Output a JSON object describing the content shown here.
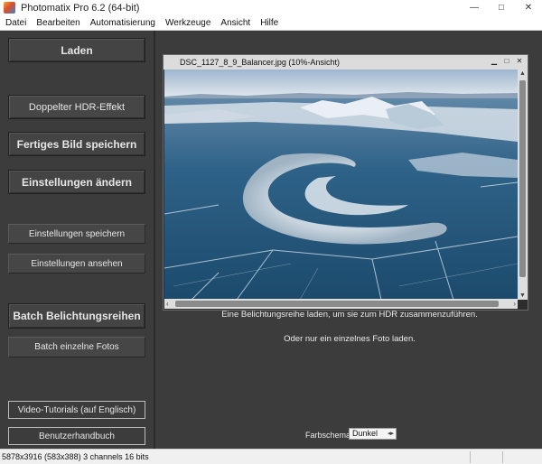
{
  "window": {
    "title": "Photomatix Pro 6.2 (64-bit)",
    "controls": [
      "—",
      "□",
      "✕"
    ]
  },
  "menu": [
    "Datei",
    "Bearbeiten",
    "Automatisierung",
    "Werkzeuge",
    "Ansicht",
    "Hilfe"
  ],
  "sidebar": {
    "load": "Laden",
    "double_hdr": "Doppelter HDR-Effekt",
    "save_final": "Fertiges Bild speichern",
    "change_settings": "Einstellungen ändern",
    "save_settings": "Einstellungen speichern",
    "view_settings": "Einstellungen ansehen",
    "batch_brackets": "Batch Belichtungsreihen",
    "batch_single": "Batch einzelne Fotos",
    "video_tutorials": "Video-Tutorials (auf Englisch)",
    "manual": "Benutzerhandbuch"
  },
  "preview": {
    "title": "DSC_1127_8_9_Balancer.jpg (10%-Ansicht)",
    "controls": [
      "▁",
      "□",
      "✕"
    ]
  },
  "messages": {
    "load_brackets": "Eine Belichtungsreihe laden, um sie zum HDR zusammenzuführen.",
    "or_single": "Oder nur ein einzelnes Foto laden."
  },
  "color_scheme": {
    "label": "Farbschema:",
    "value": "Dunkel"
  },
  "status": {
    "text": "5878x3916 (583x388) 3 channels 16 bits"
  }
}
